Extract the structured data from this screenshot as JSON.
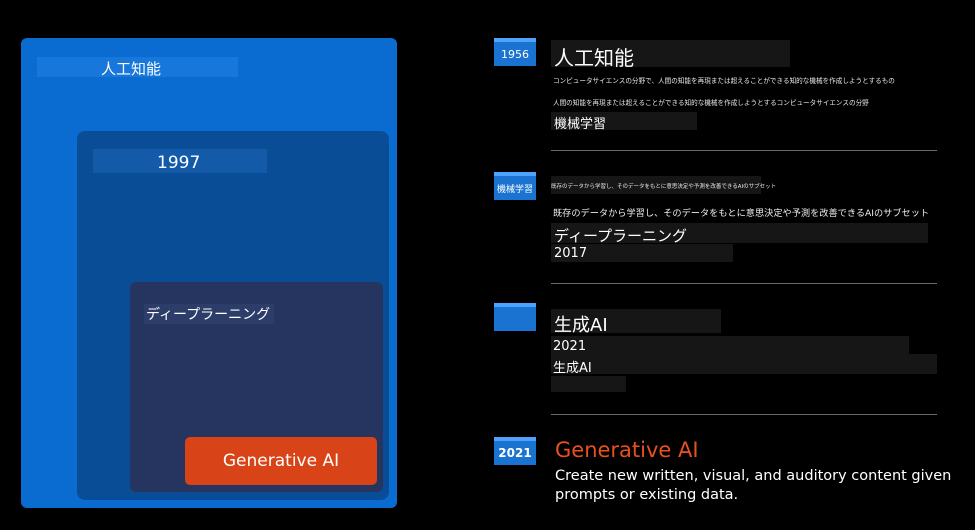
{
  "diagram": {
    "ai_label": "人工知能",
    "ml_label": "1997",
    "dl_label": "ディープラーニング",
    "gen_label": "Generative AI"
  },
  "timeline": [
    {
      "badge": "1956",
      "title": "人工知能",
      "desc1": "コンピュータサイエンスの分野で、人間の知能を再現または超えることができる知的な機械を作成しようとするもの",
      "desc2": "人間の知能を再現または超えることができる知的な機械を作成しようとするコンピュータサイエンスの分野",
      "sub": "機械学習"
    },
    {
      "badge": "機械学習",
      "tiny": "既存のデータから学習し、そのデータをもとに意思決定や予測を改善できるAIのサブセット",
      "desc": "既存のデータから学習し、そのデータをもとに意思決定や予測を改善できるAIのサブセット",
      "title": "ディープラーニング",
      "year": "2017"
    },
    {
      "badge": "",
      "title": "生成AI",
      "year": "2021",
      "sub": "生成AI"
    },
    {
      "badge": "2021",
      "title": "Generative AI",
      "desc": "Create new written, visual, and auditory content given prompts or existing data."
    }
  ],
  "colors": {
    "ai": "#0a6bd1",
    "ml": "#0a4d97",
    "dl": "#253560",
    "gen": "#d94318",
    "badge": "#1a73d0",
    "gen_title": "#e8501f"
  }
}
